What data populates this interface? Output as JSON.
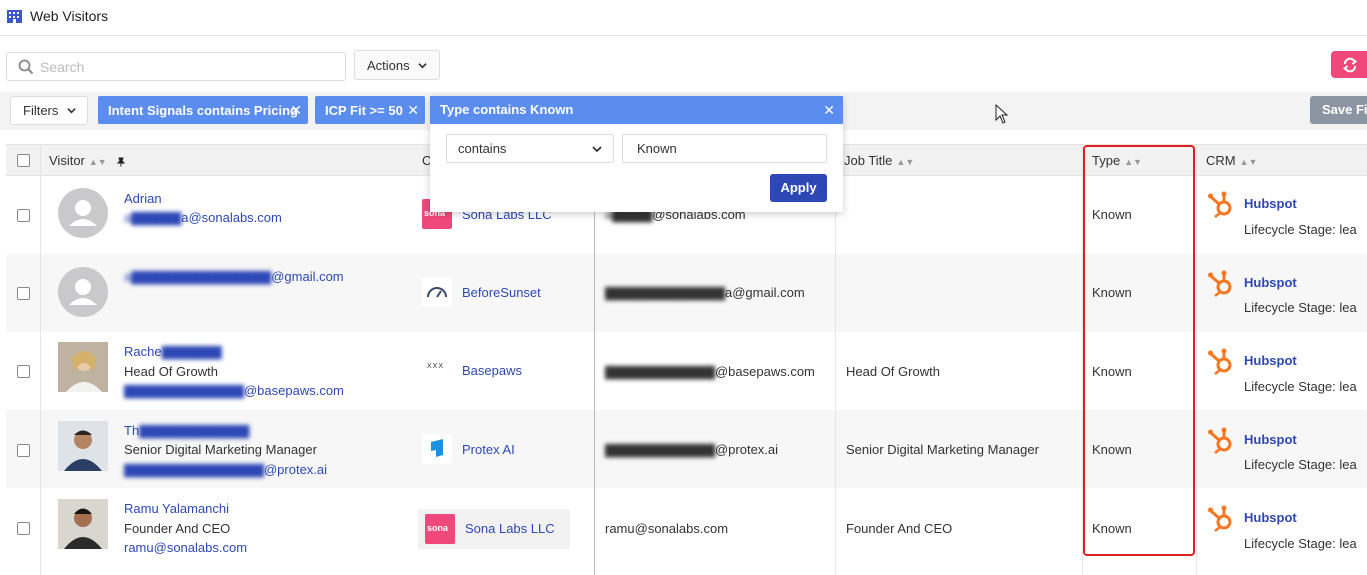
{
  "page": {
    "title": "Web Visitors"
  },
  "toolbar": {
    "search_placeholder": "Search",
    "actions_label": "Actions"
  },
  "filters": {
    "filters_label": "Filters",
    "chips": [
      "Intent Signals contains Pricing",
      "ICP Fit >= 50",
      "Type contains Known"
    ],
    "save_label": "Save Fil"
  },
  "popover": {
    "title": "Type contains Known",
    "operator": "contains",
    "value": "Known",
    "apply_label": "Apply"
  },
  "table": {
    "headers": {
      "visitor": "Visitor",
      "company": "C",
      "job_title": "Job Title",
      "type": "Type",
      "crm": "CRM"
    },
    "rows": [
      {
        "name": "Adrian",
        "title": "",
        "visitor_email": "a@sonalabs.com",
        "company": "Sona Labs LLC",
        "email": "@sonalabs.com",
        "job_title": "",
        "type": "Known",
        "crm": "Hubspot",
        "crm_stage": "Lifecycle Stage: lea"
      },
      {
        "name": "@gmail.com",
        "title": "",
        "visitor_email": "",
        "company": "BeforeSunset",
        "email": "a@gmail.com",
        "job_title": "",
        "type": "Known",
        "crm": "Hubspot",
        "crm_stage": "Lifecycle Stage: lea"
      },
      {
        "name": "Rache",
        "title": "Head Of Growth",
        "visitor_email": "@basepaws.com",
        "company": "Basepaws",
        "email": "@basepaws.com",
        "job_title": "Head Of Growth",
        "type": "Known",
        "crm": "Hubspot",
        "crm_stage": "Lifecycle Stage: lea"
      },
      {
        "name": "Th",
        "title": "Senior Digital Marketing Manager",
        "visitor_email": "@protex.ai",
        "company": "Protex AI",
        "email": "@protex.ai",
        "job_title": "Senior Digital Marketing Manager",
        "type": "Known",
        "crm": "Hubspot",
        "crm_stage": "Lifecycle Stage: lea"
      },
      {
        "name": "Ramu Yalamanchi",
        "title": "Founder And CEO",
        "visitor_email": "ramu@sonalabs.com",
        "company": "Sona Labs LLC",
        "email": "ramu@sonalabs.com",
        "job_title": "Founder And CEO",
        "type": "Known",
        "crm": "Hubspot",
        "crm_stage": "Lifecycle Stage: lea"
      }
    ]
  },
  "colors": {
    "accent": "#2d48b5",
    "chip": "#5b8def",
    "refresh": "#f0487a",
    "hubspot": "#f57722",
    "highlight": "#e02020"
  },
  "logos": {
    "sona": "sona",
    "basepaws": "XXX"
  }
}
